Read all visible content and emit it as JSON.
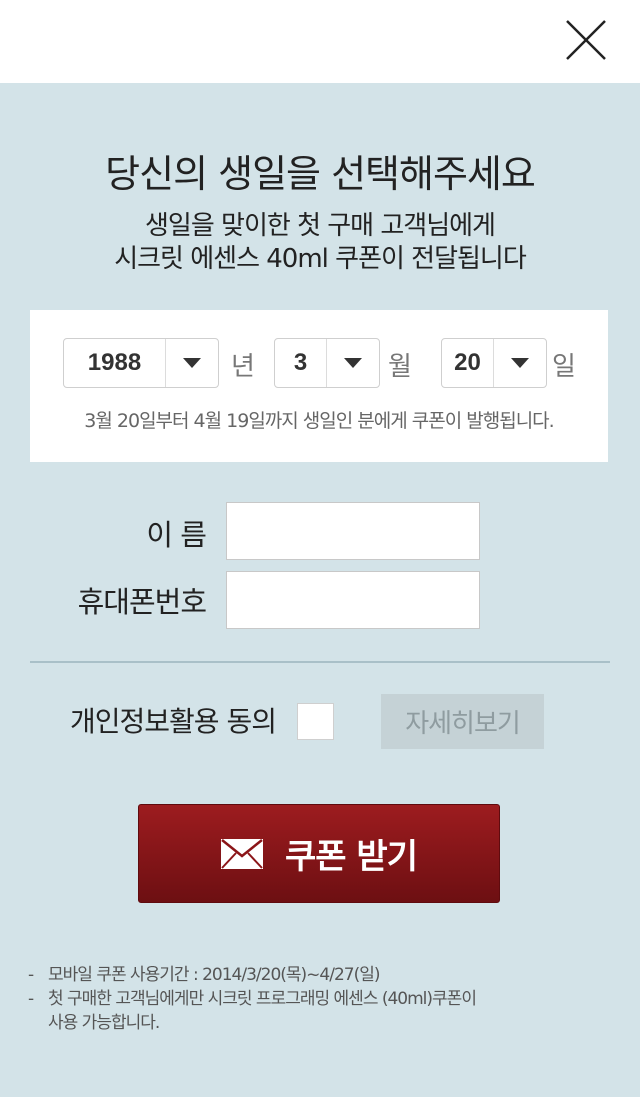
{
  "header": {
    "close_icon": "close-icon"
  },
  "title": "당신의 생일을 선택해주세요",
  "subtitle": {
    "line1": "생일을 맞이한 첫 구매 고객님에게",
    "line2": "시크릿 에센스 40ml 쿠폰이 전달됩니다"
  },
  "birthday": {
    "year": {
      "value": "1988",
      "unit": "년"
    },
    "month": {
      "value": "3",
      "unit": "월"
    },
    "day": {
      "value": "20",
      "unit": "일"
    },
    "notice": "3월 20일부터 4월 19일까지 생일인 분에게 쿠폰이 발행됩니다."
  },
  "form": {
    "name_label": "이 름",
    "name_value": "",
    "phone_label": "휴대폰번호",
    "phone_value": ""
  },
  "consent": {
    "label": "개인정보활용 동의",
    "checked": false,
    "detail_button": "자세히보기"
  },
  "coupon_button": {
    "label": "쿠폰 받기",
    "icon": "envelope-icon"
  },
  "notes": {
    "dash": "-",
    "line1": "모바일 쿠폰 사용기간 : 2014/3/20(목)~4/27(일)",
    "line2a": "첫 구매한 고객님에게만 시크릿 프로그래밍 에센스 (40ml)쿠폰이",
    "line2b": "사용 가능합니다."
  },
  "colors": {
    "background": "#d3e3e8",
    "button_red": "#8b1518",
    "detail_button_bg": "#c5d2d6"
  }
}
